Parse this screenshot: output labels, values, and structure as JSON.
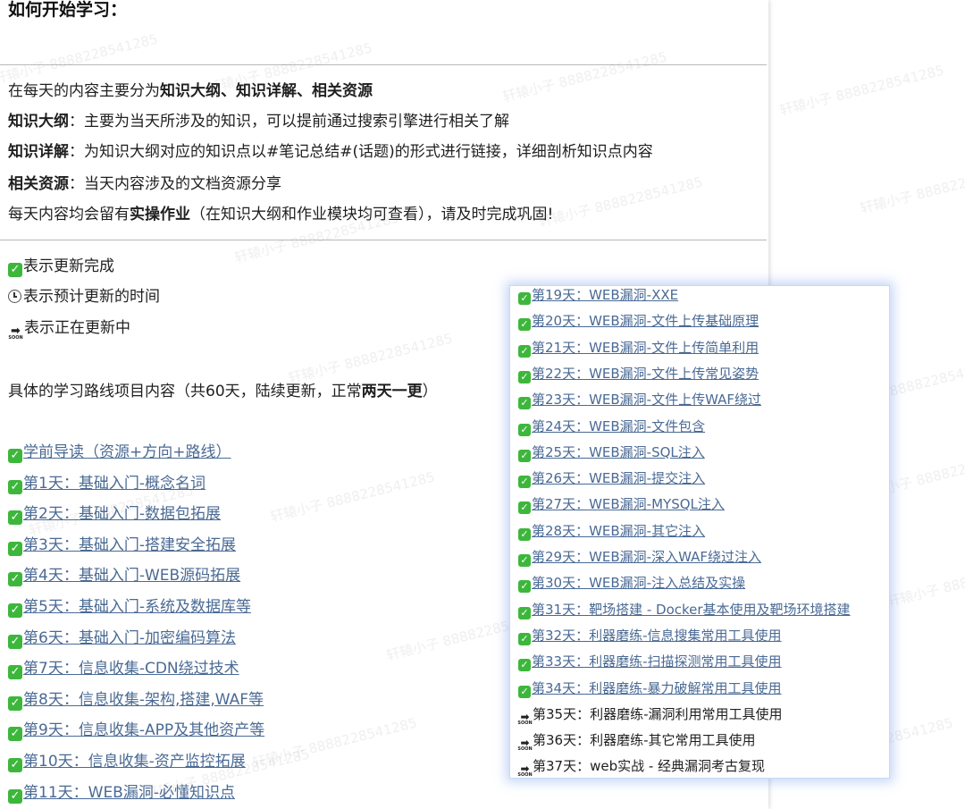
{
  "heading": "如何开始学习：",
  "intro": {
    "l1_pre": "在每天的内容主要分为",
    "l1_bold": "知识大纲、知识详解、相关资源",
    "l2_bold": "知识大纲",
    "l2_text": "：主要为当天所涉及的知识，可以提前通过搜索引擎进行相关了解",
    "l3_bold": "知识详解",
    "l3_text": "：为知识大纲对应的知识点以#笔记总结#(话题)的形式进行链接，详细剖析知识点内容",
    "l4_bold": "相关资源",
    "l4_text": "：当天内容涉及的文档资源分享",
    "l5_pre": "每天内容均会留有",
    "l5_bold": "实操作业",
    "l5_post": "（在知识大纲和作业模块均可查看），请及时完成巩固!"
  },
  "legend": {
    "done": "表示更新完成",
    "planned": "表示预计更新的时间",
    "updating": "表示正在更新中"
  },
  "roadmap": {
    "pre": "具体的学习路线项目内容（共60天，陆续更新，正常",
    "bold": "两天一更",
    "post": "）"
  },
  "main_items": [
    "学前导读（资源+方向+路线）",
    "第1天：基础入门-概念名词",
    "第2天：基础入门-数据包拓展",
    "第3天：基础入门-搭建安全拓展",
    "第4天：基础入门-WEB源码拓展",
    "第5天：基础入门-系统及数据库等",
    "第6天：基础入门-加密编码算法",
    "第7天：信息收集-CDN绕过技术",
    "第8天：信息收集-架构,搭建,WAF等",
    "第9天：信息收集-APP及其他资产等",
    "第10天：信息收集-资产监控拓展",
    "第11天：WEB漏洞-必懂知识点"
  ],
  "popup_done": [
    "第19天：WEB漏洞-XXE",
    "第20天：WEB漏洞-文件上传基础原理",
    "第21天：WEB漏洞-文件上传简单利用",
    "第22天：WEB漏洞-文件上传常见姿势",
    "第23天：WEB漏洞-文件上传WAF绕过",
    "第24天：WEB漏洞-文件包含",
    "第25天：WEB漏洞-SQL注入",
    "第26天：WEB漏洞-提交注入",
    "第27天：WEB漏洞-MYSQL注入",
    "第28天：WEB漏洞-其它注入",
    "第29天：WEB漏洞-深入WAF绕过注入",
    "第30天：WEB漏洞-注入总结及实操",
    "第31天：靶场搭建 - Docker基本使用及靶场环境搭建",
    "第32天：利器磨练-信息搜集常用工具使用",
    "第33天：利器磨练-扫描探测常用工具使用",
    "第34天：利器磨练-暴力破解常用工具使用"
  ],
  "popup_updating": [
    "第35天：利器磨练-漏洞利用常用工具使用",
    "第36天：利器磨练-其它常用工具使用",
    "第37天：web实战 - 经典漏洞考古复现"
  ],
  "soon_label": "SOON",
  "watermark": "轩辕小子 8888228541285"
}
